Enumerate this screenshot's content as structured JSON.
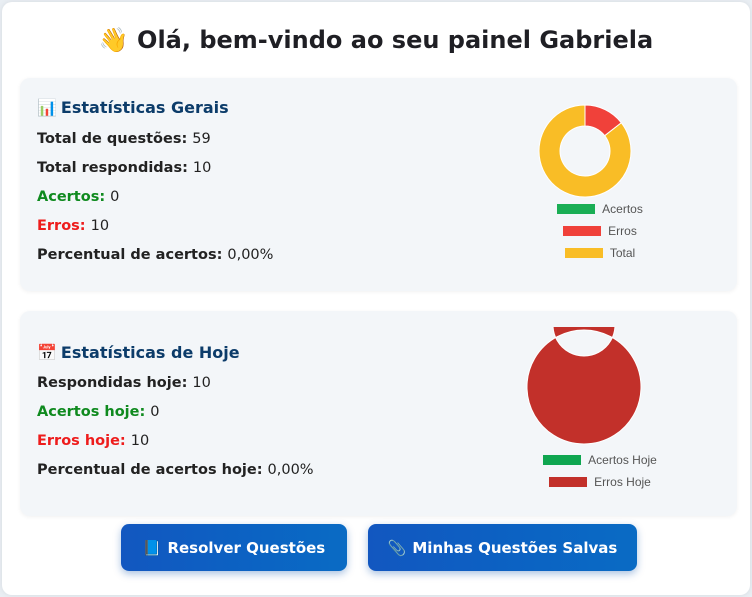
{
  "header": {
    "wave_emoji": "👋",
    "title": "Olá, bem-vindo ao seu painel Gabriela"
  },
  "general": {
    "icon": "📊",
    "icon_name": "bar-chart-icon",
    "title": "Estatísticas Gerais",
    "total_questions_label": "Total de questões:",
    "total_questions_value": "59",
    "total_answered_label": "Total respondidas:",
    "total_answered_value": "10",
    "correct_label": "Acertos:",
    "correct_value": "0",
    "errors_label": "Erros:",
    "errors_value": "10",
    "percent_label": "Percentual de acertos:",
    "percent_value": "0,00%"
  },
  "today": {
    "icon": "📅",
    "icon_name": "calendar-icon",
    "title": "Estatísticas de Hoje",
    "answered_label": "Respondidas hoje:",
    "answered_value": "10",
    "correct_label": "Acertos hoje:",
    "correct_value": "0",
    "errors_label": "Erros hoje:",
    "errors_value": "10",
    "percent_label": "Percentual de acertos hoje:",
    "percent_value": "0,00%"
  },
  "buttons": {
    "resolve_icon": "📘",
    "resolve_label": "Resolver Questões",
    "saved_icon": "📎",
    "saved_label": "Minhas Questões Salvas"
  },
  "colors": {
    "green": "#0f8a1f",
    "red": "#ee1c1c",
    "heading_blue": "#0c3c6a",
    "button_blue": "#0b63c3"
  },
  "chart_data": [
    {
      "type": "pie",
      "variant": "doughnut",
      "categories": [
        "Acertos",
        "Erros",
        "Total"
      ],
      "values": [
        0,
        10,
        59
      ],
      "colors": [
        "#1aae55",
        "#f0413a",
        "#f9bd26"
      ],
      "legend": "bottom"
    },
    {
      "type": "pie",
      "variant": "doughnut",
      "categories": [
        "Acertos Hoje",
        "Erros Hoje"
      ],
      "values": [
        0,
        10
      ],
      "colors": [
        "#0fa650",
        "#c2302a"
      ],
      "legend": "bottom"
    }
  ]
}
